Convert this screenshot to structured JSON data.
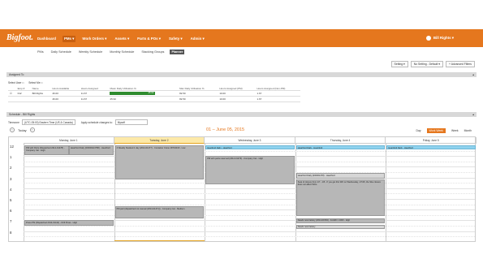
{
  "app": {
    "logo": "Bigfoot."
  },
  "nav": {
    "items": [
      {
        "label": "Dashboard",
        "active": false
      },
      {
        "label": "PMs ▾",
        "active": true
      },
      {
        "label": "Work Orders ▾",
        "active": false
      },
      {
        "label": "Assets ▾",
        "active": false
      },
      {
        "label": "Parts & POs ▾",
        "active": false
      },
      {
        "label": "Safety ▾",
        "active": false
      },
      {
        "label": "Admin ▾",
        "active": false
      }
    ],
    "user": "Bill Rights ▾"
  },
  "subnav": [
    "PMs",
    "Daily Schedule",
    "Weekly Schedule",
    "Monthly Schedule",
    "Stacking Groups",
    "Planner"
  ],
  "subnav_active": "Planner",
  "toolbar": {
    "setting": "Setting ▾",
    "saved": "No Setting - Default ▾",
    "filter": "Advanced Filters"
  },
  "assigned": {
    "title": "Assigned To",
    "select_user": "Select User",
    "select_me": "Select Me",
    "columns": [
      "Emp #",
      "Name",
      "Hours Available",
      "Hours Assigned",
      "Mean Daily Utilisation %",
      "Max Daily Utilisation %",
      "Hours Assigned (PM)",
      "Hours Assigned (Non-PM)"
    ],
    "rows": [
      {
        "emp": "012",
        "name": "Bill Rights",
        "avail": "46.00",
        "assigned": "11.67",
        "mean": "25.62",
        "max": "82.50",
        "pm": "10.00",
        "nonpm": "1.67"
      },
      {
        "emp": "",
        "name": "",
        "avail": "46.00",
        "assigned": "11.67",
        "mean": "25.62",
        "max": "82.50",
        "pm": "10.00",
        "nonpm": "1.67"
      }
    ]
  },
  "schedule": {
    "title": "Schedule - Bill Rights",
    "timezone_label": "Timezone",
    "timezone": "(UTC-05:00) Eastern Time (US & Canada)",
    "apply_label": "Apply schedule changes to:",
    "apply_value": "Myself",
    "today": "Today",
    "date_range": "01 – June 05, 2015",
    "views": [
      "Day",
      "Work Week",
      "Week",
      "Month"
    ],
    "active_view": "Work Week",
    "days": [
      "Monday, June 1",
      "Tuesday, June 2",
      "Wednesday, June 3",
      "Thursday, June 4",
      "Friday, June 5"
    ],
    "today_index": 1,
    "hours": [
      "12",
      "1",
      "2",
      "3",
      "4",
      "5",
      "6",
      "7",
      "8"
    ],
    "events": [
      {
        "day": 0,
        "start": 0.0,
        "end": 0.9,
        "color": "gray",
        "text": "PM with Parts (Dispatched 2014-01478) - Company Car - High"
      },
      {
        "day": 0,
        "start": 0.0,
        "end": 0.9,
        "color": "gray",
        "text": "Heartford Daily (000000A4758) - Heartford",
        "offset": 1
      },
      {
        "day": 0,
        "start": 7.0,
        "end": 7.5,
        "color": "gray",
        "text": "Press PM (Dispatched 2014-01414) - Drill Press - High"
      },
      {
        "day": 1,
        "start": 0.0,
        "end": 3.2,
        "color": "gray",
        "text": "2 Weekly Stacked 1 day (2014-01477) - Container Crane 28704340 - Low"
      },
      {
        "day": 1,
        "start": 5.7,
        "end": 6.8,
        "color": "gray",
        "text": "PM part (dispatched not manual (2014-01471)) - Company Car - Medium"
      },
      {
        "day": 2,
        "start": 0.0,
        "end": 0.4,
        "color": "blue",
        "text": "Heartford Daily - Heartford"
      },
      {
        "day": 2,
        "start": 1.0,
        "end": 3.6,
        "color": "gray",
        "text": "PM with parts reserved (2014-01479) - Company Car - High"
      },
      {
        "day": 3,
        "start": 0.0,
        "end": 0.4,
        "color": "blue",
        "text": "Heartford Daily - Heartford"
      },
      {
        "day": 3,
        "start": 2.6,
        "end": 3.1,
        "color": "light",
        "text": "Heartford Daily (000001478) - Heartford"
      },
      {
        "day": 3,
        "start": 3.2,
        "end": 6.6,
        "color": "gray",
        "text": "Seat of closure from 1/7 - 1/5 - If you get this WO on Wednesday, 1/7/15, the Site closure does not affect WOs."
      },
      {
        "day": 3,
        "start": 6.8,
        "end": 7.3,
        "color": "gray",
        "text": "Needs new battery (2014-01563) - Forklift 1 1000 - High"
      },
      {
        "day": 3,
        "start": 7.4,
        "end": 7.8,
        "color": "light",
        "text": "Needs new battery"
      },
      {
        "day": 4,
        "start": 0.0,
        "end": 0.4,
        "color": "blue",
        "text": "Heartford Daily - Heartford"
      }
    ]
  }
}
